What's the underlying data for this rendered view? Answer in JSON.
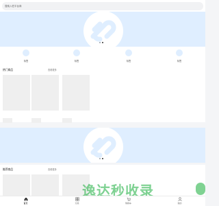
{
  "search": {
    "placeholder": "搜索入驻平台商"
  },
  "banner": {
    "active_index": 1,
    "dot_count": 2
  },
  "categories": [
    {
      "label": "标签"
    },
    {
      "label": "标签"
    },
    {
      "label": "标签"
    },
    {
      "label": "标签"
    }
  ],
  "hot_section": {
    "title": "热门商品",
    "more_label": "查看更多"
  },
  "recommend_section": {
    "title": "推荐商品",
    "more_label": "查看更多"
  },
  "watermark": {
    "text": "逸达秒收录"
  },
  "tabbar": [
    {
      "label": "首页",
      "icon": "home-icon",
      "active": true
    },
    {
      "label": "分类",
      "icon": "grid-icon",
      "active": false
    },
    {
      "label": "购物车",
      "icon": "cart-icon",
      "active": false
    },
    {
      "label": "我的",
      "icon": "user-icon",
      "active": false
    }
  ],
  "colors": {
    "banner_bg": "#dfeeff",
    "page_bg": "#f4f5f7",
    "watermark": "#2ab44a"
  }
}
